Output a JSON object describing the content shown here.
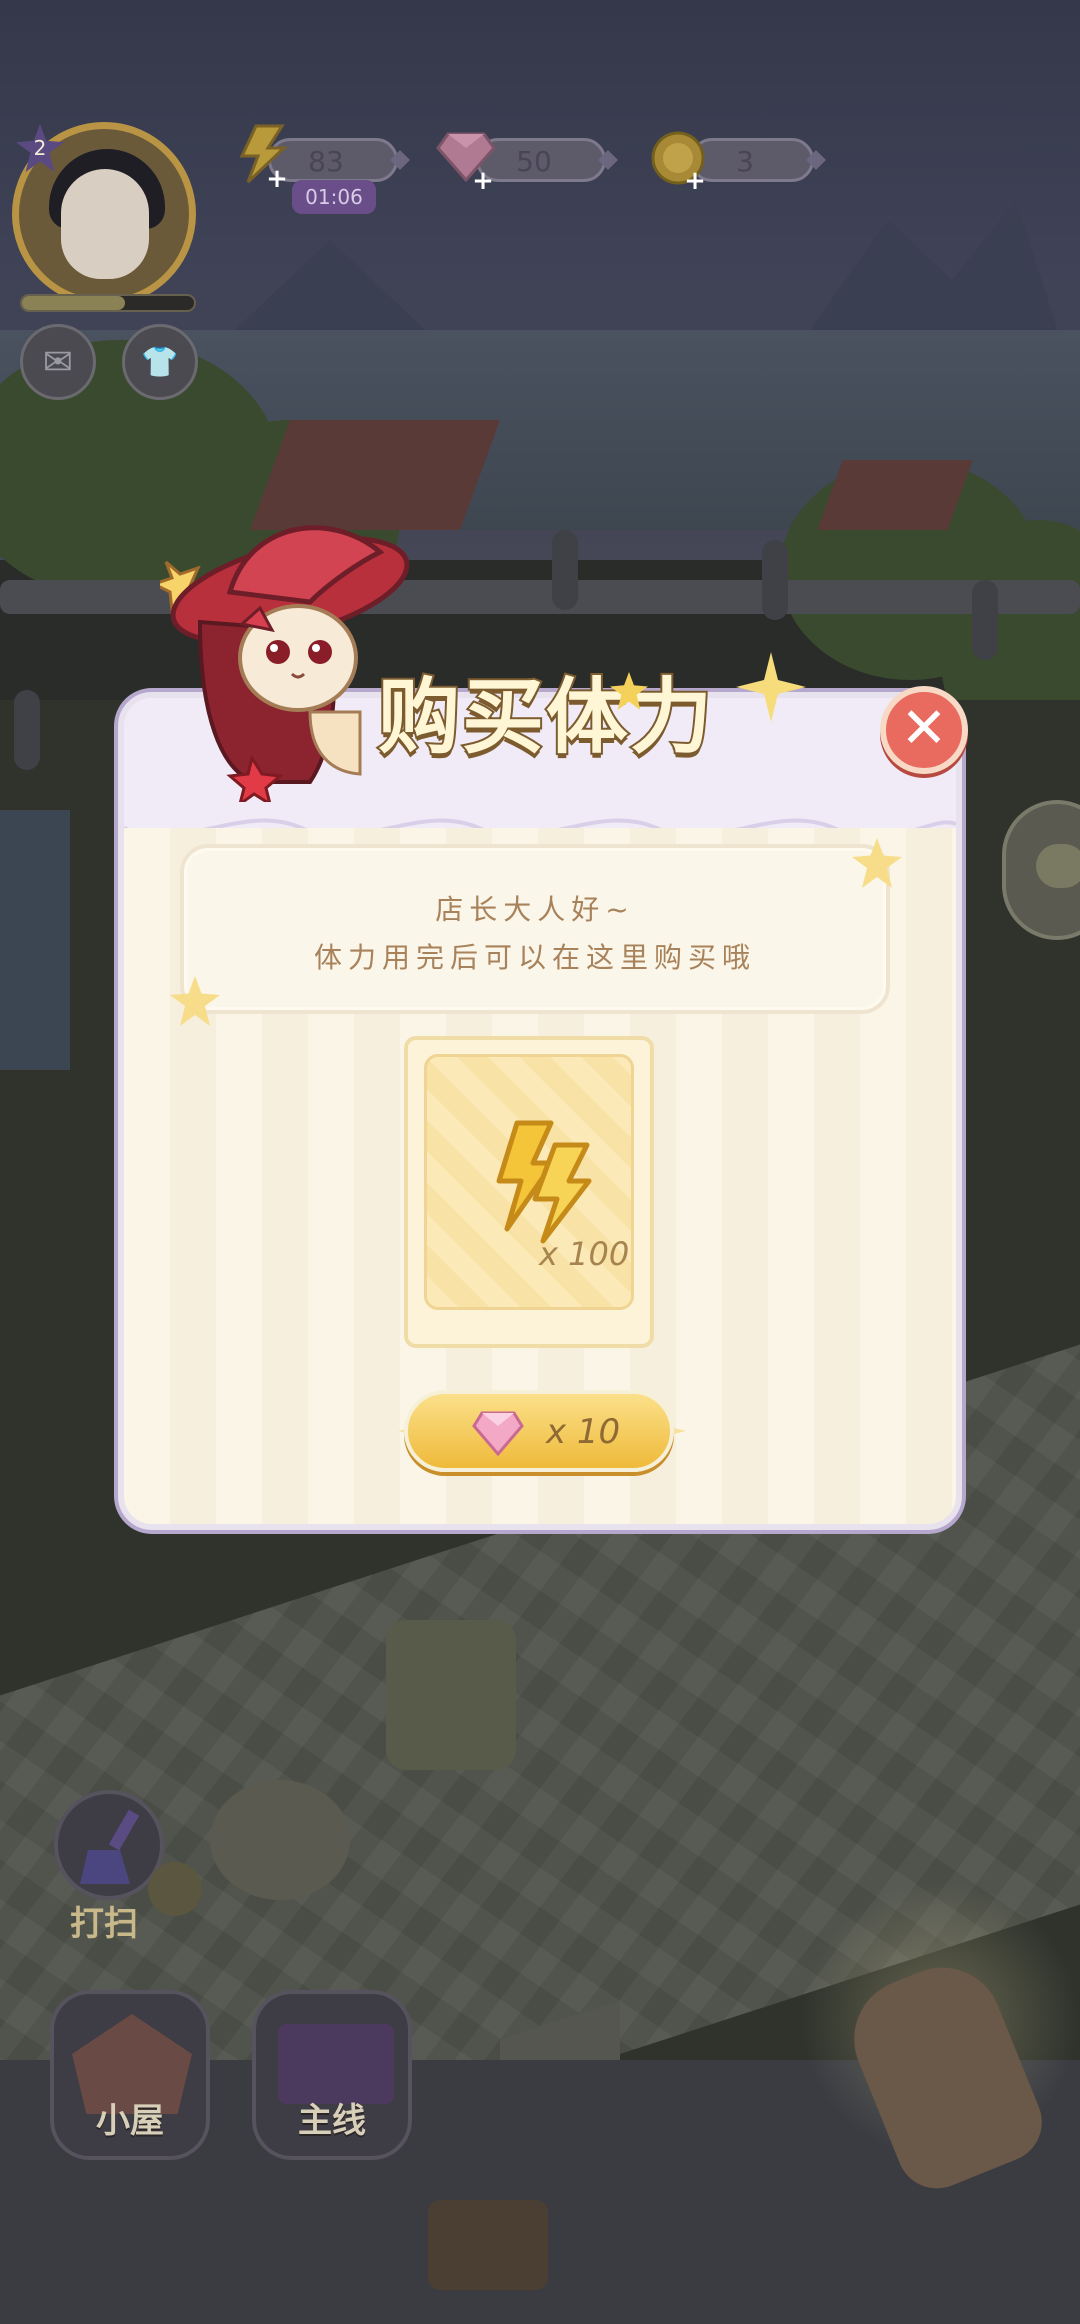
{
  "hud": {
    "level": "2",
    "energy": {
      "value": "83",
      "timer": "01:06",
      "icon": "lightning-icon"
    },
    "gems": {
      "value": "50",
      "icon": "pink-gem-icon"
    },
    "coins": {
      "value": "3",
      "icon": "gold-coin-icon"
    },
    "xp_fraction": 0.6
  },
  "side_buttons": {
    "mail_icon": "envelope-icon",
    "wardrobe_icon": "shirt-icon",
    "chat_icon": "chat-bubble-icon"
  },
  "bottom": {
    "sweep_label": "打扫",
    "house_label": "小屋",
    "story_label": "主线"
  },
  "dialog": {
    "title": "购买体力",
    "close_icon": "close-icon",
    "notice_line1": "店长大人好~",
    "notice_line2": "体力用完后可以在这里购买哦",
    "item": {
      "icon": "lightning-icon",
      "quantity": "x 100"
    },
    "buy": {
      "currency_icon": "pink-gem-icon",
      "price": "x 10"
    }
  },
  "colors": {
    "dialog_bg": "#f3e9d6",
    "header_bg": "#f1ebf7",
    "close_red": "#e96a5e",
    "button_gold": "#efba3a",
    "text_brown": "#a8825a"
  }
}
